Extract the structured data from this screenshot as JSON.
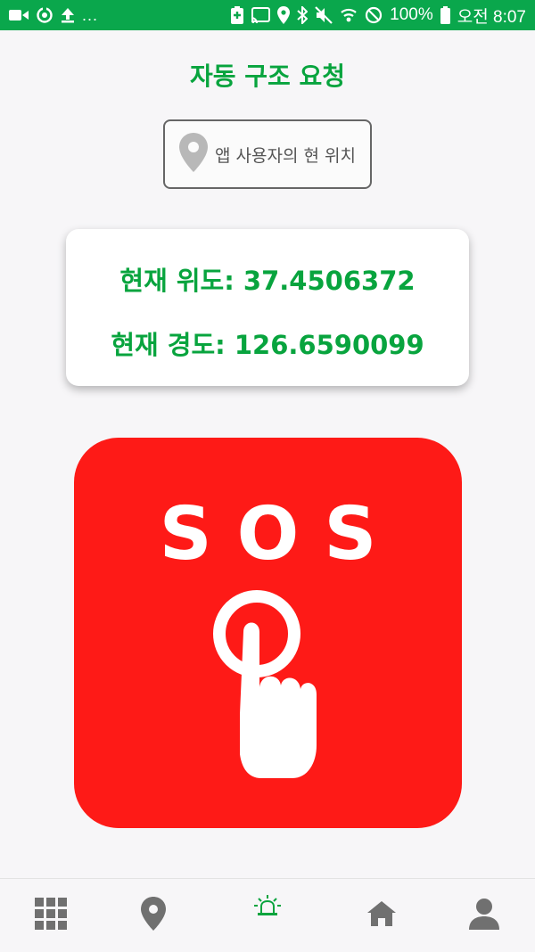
{
  "status_bar": {
    "left_icons": [
      "video-camera-icon",
      "circular-arrows-icon",
      "upload-arrow-icon"
    ],
    "overflow": "...",
    "right_icons": [
      "battery-saver-icon",
      "cast-icon",
      "location-pin-icon",
      "bluetooth-icon",
      "mute-icon",
      "wifi-icon",
      "do-not-disturb-icon"
    ],
    "battery": "100%",
    "time": "오전 8:07"
  },
  "header": {
    "title": "자동 구조 요청"
  },
  "location_button": {
    "icon": "location-pin-icon",
    "label": "앱 사용자의 현 위치"
  },
  "coordinates": {
    "latitude": "현재 위도: 37.4506372",
    "longitude": "현재 경도: 126.6590099"
  },
  "sos_button": {
    "text": "SOS",
    "icon": "finger-press-icon"
  },
  "bottom_nav": {
    "items": [
      {
        "id": "menu",
        "icon": "grid-icon",
        "active": false
      },
      {
        "id": "location",
        "icon": "location-pin-icon",
        "active": false
      },
      {
        "id": "sos",
        "icon": "siren-icon",
        "active": true
      },
      {
        "id": "home",
        "icon": "home-icon",
        "active": false
      },
      {
        "id": "profile",
        "icon": "person-icon",
        "active": false
      }
    ]
  },
  "colors": {
    "status_bar": "#0aa74c",
    "accent_green": "#08a43e",
    "sos_red": "#fe1a17",
    "background": "#f7f6f8",
    "nav_icon": "#707070"
  }
}
